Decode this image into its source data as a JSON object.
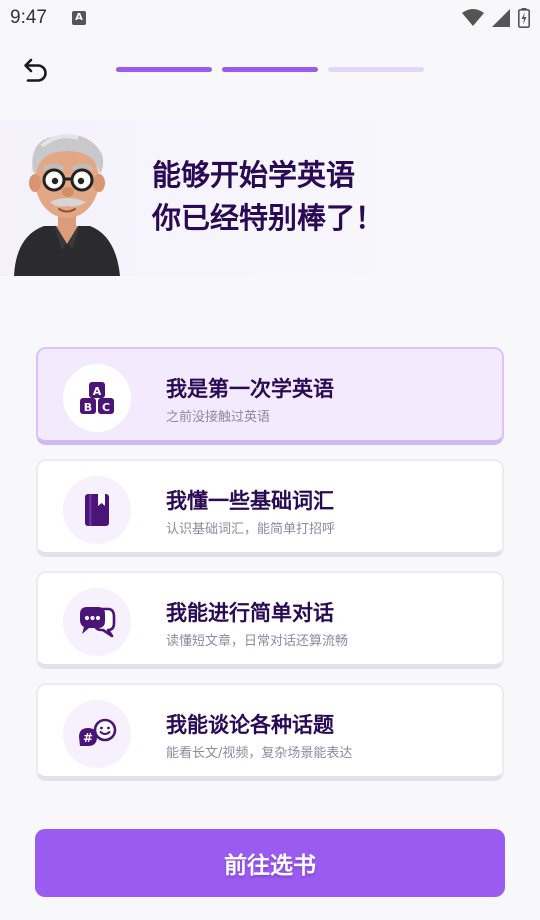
{
  "status_bar": {
    "time": "9:47",
    "notification_icon": "a-icon"
  },
  "header": {
    "back_icon": "back-arrow-icon",
    "progress": {
      "total_steps": 3,
      "completed_steps": 2,
      "active_color": "#9a5bf0",
      "inactive_color": "#e3d5fb"
    }
  },
  "hero": {
    "line1": "能够开始学英语",
    "line2": "你已经特别棒了！"
  },
  "options": [
    {
      "title": "我是第一次学英语",
      "subtitle": "之前没接触过英语",
      "icon": "abc-blocks-icon",
      "selected": true
    },
    {
      "title": "我懂一些基础词汇",
      "subtitle": "认识基础词汇，能简单打招呼",
      "icon": "book-icon",
      "selected": false
    },
    {
      "title": "我能进行简单对话",
      "subtitle": "读懂短文章，日常对话还算流畅",
      "icon": "chat-bubbles-icon",
      "selected": false
    },
    {
      "title": "我能谈论各种话题",
      "subtitle": "能看长文/视频，复杂场景能表达",
      "icon": "hashtag-smile-icon",
      "selected": false
    }
  ],
  "cta": {
    "label": "前往选书"
  },
  "colors": {
    "brand_purple": "#9a5bf0",
    "title_dark": "#2a0a55",
    "icon_purple": "#4a1577"
  }
}
